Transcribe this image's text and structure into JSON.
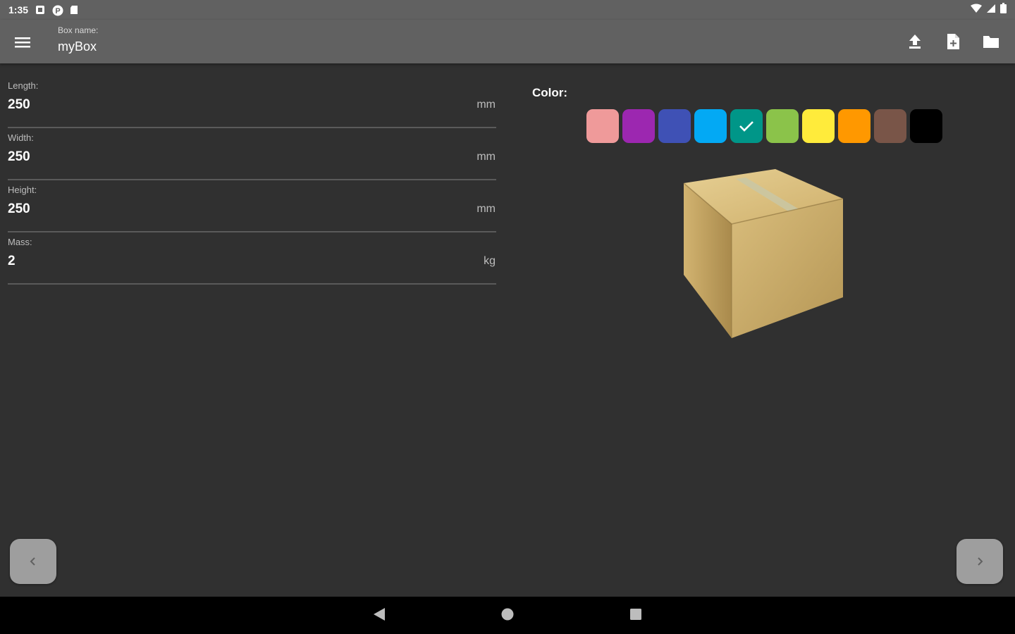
{
  "status_bar": {
    "time": "1:35",
    "icons": [
      "notification-square-icon",
      "p-badge-icon",
      "sd-card-icon",
      "wifi-icon",
      "signal-icon",
      "battery-icon"
    ]
  },
  "toolbar": {
    "title_label": "Box name:",
    "title_value": "myBox",
    "actions": [
      "upload-icon",
      "new-file-icon",
      "folder-icon"
    ]
  },
  "fields": [
    {
      "label": "Length:",
      "value": "250",
      "unit": "mm"
    },
    {
      "label": "Width:",
      "value": "250",
      "unit": "mm"
    },
    {
      "label": "Height:",
      "value": "250",
      "unit": "mm"
    },
    {
      "label": "Mass:",
      "value": "2",
      "unit": "kg"
    }
  ],
  "color_panel": {
    "label": "Color:",
    "selected_index": 4,
    "colors": [
      "#ef9a9a",
      "#9c27b0",
      "#3f51b5",
      "#03a9f4",
      "#009688",
      "#8bc34a",
      "#ffeb3b",
      "#ff9800",
      "#795548",
      "#000000"
    ]
  },
  "navigation": {
    "prev_icon": "chevron-left-icon",
    "next_icon": "chevron-right-icon"
  },
  "colors": {
    "background": "#303030",
    "toolbar": "#616161",
    "nav_button": "#9e9e9e",
    "system_nav": "#000000"
  }
}
